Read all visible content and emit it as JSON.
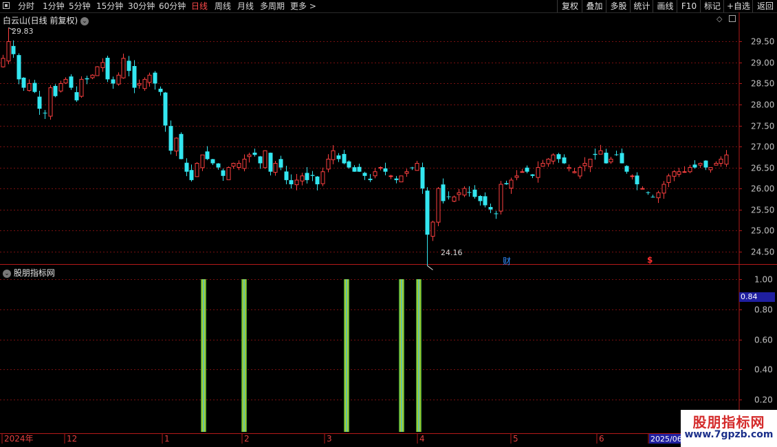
{
  "toolbar": {
    "periods": [
      "分时",
      "1分钟",
      "5分钟",
      "15分钟",
      "30分钟",
      "60分钟",
      "日线",
      "周线",
      "月线",
      "多周期",
      "更多 >"
    ],
    "active_period": "日线",
    "right_buttons": [
      "复权",
      "叠加",
      "多股",
      "统计",
      "画线",
      "F10",
      "标记",
      "+自选",
      "返回"
    ]
  },
  "main_chart": {
    "title": "白云山(日线 前复权)",
    "y_ticks": [
      "29.50",
      "29.00",
      "28.50",
      "28.00",
      "27.50",
      "27.00",
      "26.50",
      "26.00",
      "25.50",
      "25.00",
      "24.50"
    ],
    "max_label": "29.83",
    "min_label": "24.16",
    "event_marks": [
      {
        "text": "财",
        "color": "#2f8cff"
      },
      {
        "text": "$",
        "color": "#ff3030"
      }
    ],
    "colors": {
      "up": "#ff4040",
      "down": "#33e6f0",
      "grid": "#7a1010",
      "frame": "#b51a1a",
      "axis_text": "#c0c0c0"
    }
  },
  "indicator": {
    "title": "股朋指标网",
    "y_ticks": [
      "1.00",
      "0.80",
      "0.60",
      "0.40",
      "0.20"
    ],
    "current_value": "0.84",
    "signal_count": 5
  },
  "date_axis": {
    "labels": [
      "2024年",
      "12",
      "1",
      "2",
      "3",
      "4",
      "5",
      "6",
      "2025/06"
    ]
  },
  "watermark": {
    "line1": "股朋指标网",
    "line2": "www.7gpzb.com"
  },
  "chart_data": {
    "type": "candlestick",
    "title": "白云山(日线 前复权)",
    "price_range": [
      24.16,
      29.83
    ],
    "ylim": [
      24.2,
      29.9
    ],
    "closes": [
      29.1,
      29.5,
      29.2,
      28.6,
      28.4,
      28.5,
      28.3,
      27.9,
      27.8,
      28.4,
      28.2,
      28.5,
      28.6,
      28.4,
      28.1,
      28.6,
      28.6,
      28.7,
      28.9,
      29.0,
      28.6,
      28.5,
      28.7,
      29.1,
      28.8,
      28.4,
      28.5,
      28.6,
      28.7,
      28.5,
      28.3,
      27.5,
      26.9,
      27.2,
      26.7,
      26.4,
      26.2,
      26.6,
      26.8,
      26.7,
      26.6,
      26.5,
      26.3,
      26.5,
      26.6,
      26.6,
      26.7,
      26.8,
      26.8,
      26.6,
      26.9,
      26.4,
      26.6,
      26.5,
      26.2,
      26.1,
      26.2,
      26.3,
      26.2,
      26.3,
      26.1,
      26.4,
      26.7,
      26.9,
      26.7,
      26.6,
      26.5,
      26.4,
      26.4,
      26.3,
      26.2,
      26.4,
      26.5,
      26.4,
      26.3,
      26.2,
      26.3,
      26.4,
      26.5,
      26.6,
      26.0,
      24.9,
      25.2,
      26.0,
      25.7,
      25.8,
      25.8,
      25.9,
      26.0,
      25.9,
      25.8,
      25.7,
      25.6,
      25.5,
      25.4,
      26.1,
      26.1,
      26.2,
      26.3,
      26.4,
      26.4,
      26.3,
      26.5,
      26.6,
      26.7,
      26.8,
      26.7,
      26.6,
      26.5,
      26.4,
      26.5,
      26.6,
      26.7,
      26.8,
      26.9,
      26.6,
      26.7,
      26.8,
      26.6,
      26.4,
      26.3,
      26.1,
      26.0,
      25.9,
      25.8,
      25.9,
      26.1,
      26.3,
      26.4,
      26.4,
      26.4,
      26.5,
      26.5,
      26.6,
      26.5,
      26.5,
      26.6,
      26.7,
      26.8
    ],
    "signals": [
      0,
      0,
      0,
      0,
      0,
      0,
      0,
      0,
      0,
      0,
      0,
      0,
      0,
      0,
      0,
      0,
      0,
      0,
      0,
      0,
      0,
      0,
      0,
      0,
      0,
      0,
      0,
      0,
      0,
      0,
      0,
      0,
      0,
      0,
      0,
      0,
      0,
      0,
      0,
      0,
      0,
      0,
      0,
      0,
      0,
      0,
      0,
      0,
      0,
      0,
      0,
      0,
      0,
      0,
      0,
      0,
      0,
      0,
      0,
      0,
      0,
      0,
      0,
      0,
      0,
      0,
      0,
      0,
      0,
      0,
      0,
      0,
      0,
      0,
      0,
      0,
      0,
      0,
      0,
      0,
      0,
      0,
      0,
      0,
      0,
      0,
      0,
      0,
      0,
      0,
      0,
      0,
      0,
      0,
      0,
      0,
      0,
      0,
      0,
      0,
      0,
      0,
      0,
      0,
      0,
      0,
      0,
      0,
      0,
      0,
      0,
      0,
      0,
      0,
      0,
      0,
      0,
      0,
      0,
      0,
      0,
      0,
      0,
      0,
      0,
      0,
      0,
      0,
      0,
      0,
      0,
      0,
      0,
      0,
      0,
      0,
      0,
      0,
      0,
      0,
      0
    ]
  }
}
